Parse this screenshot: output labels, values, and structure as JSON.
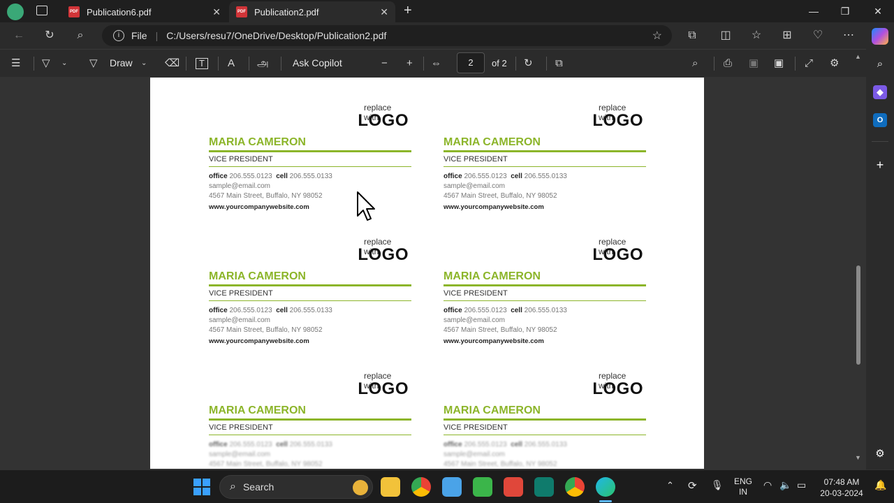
{
  "tabs": [
    {
      "label": "Publication6.pdf"
    },
    {
      "label": "Publication2.pdf"
    }
  ],
  "address": {
    "scheme_label": "File",
    "url": "C:/Users/resu7/OneDrive/Desktop/Publication2.pdf"
  },
  "toolbar": {
    "draw_label": "Draw",
    "copilot_label": "Ask Copilot",
    "page_current": "2",
    "page_total": "of 2"
  },
  "card": {
    "replace_text": "replace with",
    "logo_text": "LOGO",
    "name": "MARIA CAMERON",
    "title": "VICE PRESIDENT",
    "office_label": "office",
    "office_phone": "206.555.0123",
    "cell_label": "cell",
    "cell_phone": "206.555.0133",
    "email": "sample@email.com",
    "address": "4567 Main Street, Buffalo, NY 98052",
    "website": "www.yourcompanywebsite.com"
  },
  "taskbar": {
    "search_label": "Search",
    "lang_line1": "ENG",
    "lang_line2": "IN",
    "time": "07:48 AM",
    "date": "20-03-2024"
  },
  "colors": {
    "accent_green": "#8cb52a",
    "pdf_icon_red": "#d13438"
  }
}
